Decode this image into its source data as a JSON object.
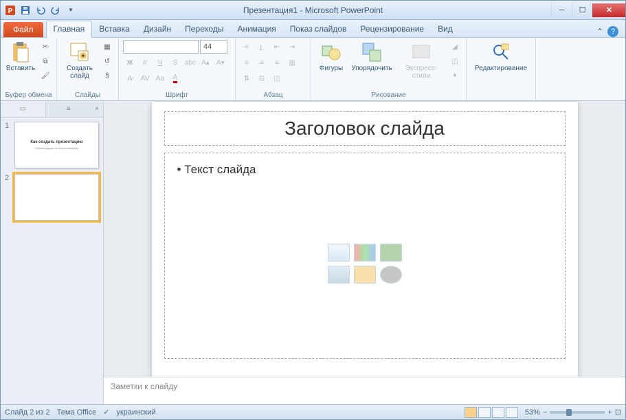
{
  "title": "Презентация1 - Microsoft PowerPoint",
  "qat": {
    "save": "save",
    "undo": "undo",
    "redo": "redo"
  },
  "tabs": {
    "file": "Файл",
    "items": [
      "Главная",
      "Вставка",
      "Дизайн",
      "Переходы",
      "Анимация",
      "Показ слайдов",
      "Рецензирование",
      "Вид"
    ],
    "active": 0
  },
  "ribbon": {
    "clipboard": {
      "label": "Буфер обмена",
      "paste": "Вставить"
    },
    "slides": {
      "label": "Слайды",
      "new": "Создать\nслайд"
    },
    "font": {
      "label": "Шрифт",
      "size": "44"
    },
    "paragraph": {
      "label": "Абзац"
    },
    "drawing": {
      "label": "Рисование",
      "shapes": "Фигуры",
      "arrange": "Упорядочить",
      "quick": "Экспресс-стили"
    },
    "editing": {
      "label": "Редактирование"
    }
  },
  "panel": {
    "tab_slides": "Слайды",
    "tab_outline": "Структура",
    "thumbs": [
      {
        "n": "1",
        "title": "Как создать презентацию",
        "sub": "Рекомендации по использованию"
      },
      {
        "n": "2",
        "title": "",
        "sub": ""
      }
    ],
    "selected": 1
  },
  "slide": {
    "title": "Заголовок слайда",
    "body": "Текст слайда"
  },
  "notes": "Заметки к слайду",
  "status": {
    "slide": "Слайд 2 из 2",
    "theme": "Тема Office",
    "lang": "украинский",
    "zoom": "53%"
  }
}
